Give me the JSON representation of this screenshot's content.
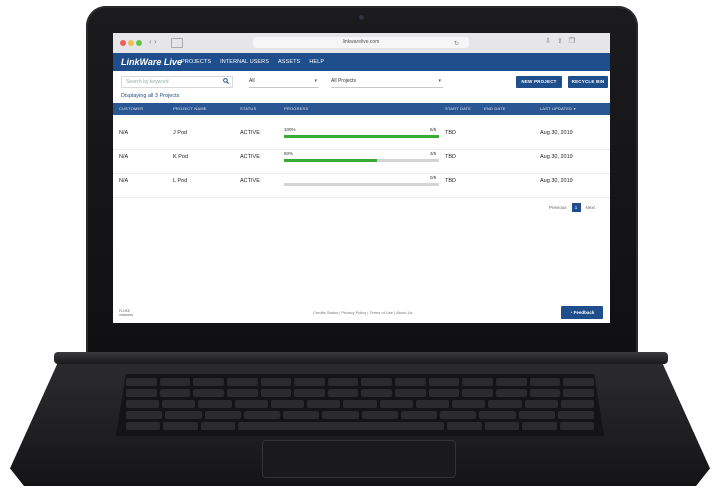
{
  "browser": {
    "url": "linkwarelive.com"
  },
  "app": {
    "brand": "LinkWare Live",
    "nav": [
      "PROJECTS",
      "INTERNAL USERS",
      "ASSETS",
      "HELP"
    ]
  },
  "toolbar": {
    "search_placeholder": "Search by keyword",
    "filter1": "All",
    "filter2": "All Projects",
    "new_project": "NEW PROJECT",
    "recycle_bin": "RECYCLE BIN"
  },
  "count_text": "Displaying all 3 Projects",
  "table": {
    "headers": [
      "CUSTOMER",
      "PROJECT NAME",
      "STATUS",
      "PROGRESS",
      "START DATE",
      "END DATE",
      "LAST UPDATED ▾"
    ],
    "rows": [
      {
        "customer": "N/A",
        "project": "J Pod",
        "status": "ACTIVE",
        "progress_pct": 100,
        "progress_label": "100%",
        "fraction": "5/5",
        "start": "TBD",
        "end": "",
        "updated": "Aug 30, 2019"
      },
      {
        "customer": "N/A",
        "project": "K Pod",
        "status": "ACTIVE",
        "progress_pct": 60,
        "progress_label": "60%",
        "fraction": "3/5",
        "start": "TBD",
        "end": "",
        "updated": "Aug 30, 2019"
      },
      {
        "customer": "N/A",
        "project": "L Pod",
        "status": "ACTIVE",
        "progress_pct": 0,
        "progress_label": "",
        "fraction": "0/5",
        "start": "TBD",
        "end": "",
        "updated": "Aug 30, 2019"
      }
    ]
  },
  "pagination": {
    "previous": "Previous",
    "current": "1",
    "next": "Next"
  },
  "footer": {
    "logo_line1": "FLUKE",
    "logo_line2": "networks",
    "links": "Credits Status | Privacy Policy | Terms of Use | About Us",
    "feedback": "Feedback"
  },
  "colors": {
    "brand_blue": "#1f4e8c",
    "progress_green": "#3aaa35"
  },
  "icons": [
    "search-icon",
    "chevron-down-icon",
    "feedback-icon"
  ]
}
